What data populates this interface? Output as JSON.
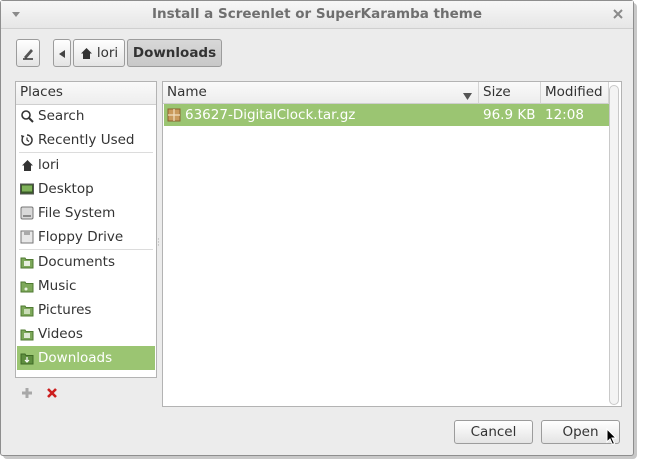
{
  "window": {
    "title": "Install a Screenlet or SuperKaramba theme"
  },
  "path_bar": {
    "home_label": "lori",
    "current_label": "Downloads"
  },
  "places": {
    "header": "Places",
    "items": [
      {
        "label": "Search",
        "icon": "search-icon"
      },
      {
        "label": "Recently Used",
        "icon": "recent-icon"
      },
      {
        "label": "lori",
        "icon": "home-icon"
      },
      {
        "label": "Desktop",
        "icon": "desktop-icon"
      },
      {
        "label": "File System",
        "icon": "drive-icon"
      },
      {
        "label": "Floppy Drive",
        "icon": "floppy-icon"
      },
      {
        "label": "Documents",
        "icon": "folder-icon"
      },
      {
        "label": "Music",
        "icon": "folder-icon"
      },
      {
        "label": "Pictures",
        "icon": "folder-icon"
      },
      {
        "label": "Videos",
        "icon": "folder-icon"
      },
      {
        "label": "Downloads",
        "icon": "folder-icon"
      }
    ],
    "selected": "Downloads"
  },
  "files": {
    "columns": {
      "name": "Name",
      "size": "Size",
      "modified": "Modified"
    },
    "rows": [
      {
        "name": "63627-DigitalClock.tar.gz",
        "size": "96.9 KB",
        "modified": "12:08",
        "icon": "archive-icon"
      }
    ]
  },
  "buttons": {
    "cancel": "Cancel",
    "open": "Open"
  },
  "colors": {
    "selection": "#9bc572",
    "remove": "#cc1f1f"
  }
}
